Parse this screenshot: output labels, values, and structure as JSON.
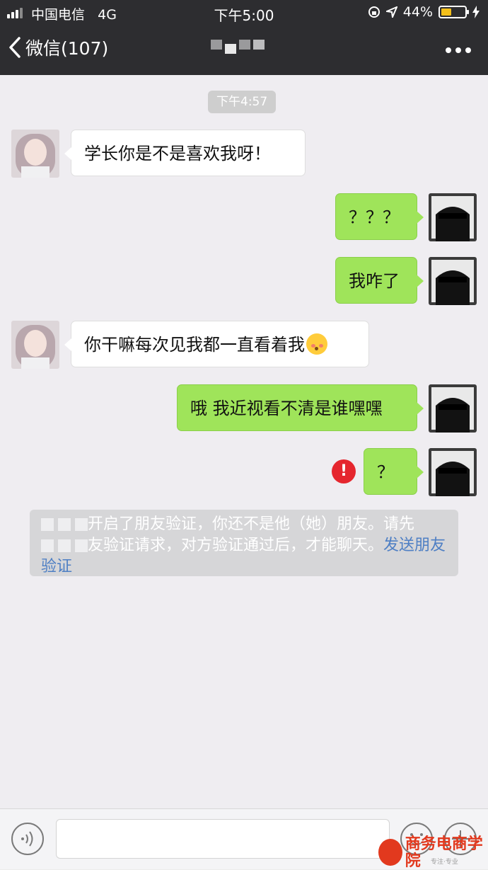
{
  "status_bar": {
    "carrier": "中国电信",
    "network": "4G",
    "time": "下午5:00",
    "battery_percent": "44%",
    "battery_level": 0.44
  },
  "nav": {
    "back_label": "微信(107)"
  },
  "chat": {
    "timestamp": "下午4:57",
    "messages": [
      {
        "side": "left",
        "text": "学长你是不是喜欢我呀！"
      },
      {
        "side": "right",
        "text": "？？？"
      },
      {
        "side": "right",
        "text": "我咋了"
      },
      {
        "side": "left",
        "text": "你干嘛每次见我都一直看着我"
      },
      {
        "side": "right",
        "text": "哦 我近视看不清是谁嘿嘿"
      },
      {
        "side": "right",
        "text": "？",
        "failed": true
      }
    ],
    "notice": {
      "text_line1": "开启了朋友验证，你还不是他（她）朋友。请先",
      "text_line2_prefix": "友验证请求，对方验证通过后，才能聊天。",
      "link": "发送朋友验证"
    }
  },
  "watermark": {
    "brand": "商务电商学院",
    "slogan": "专注·专业"
  },
  "colors": {
    "nav_bg": "#2d2d30",
    "my_bubble": "#9fe45a",
    "error": "#e5262e",
    "link": "#4e7fc4"
  }
}
